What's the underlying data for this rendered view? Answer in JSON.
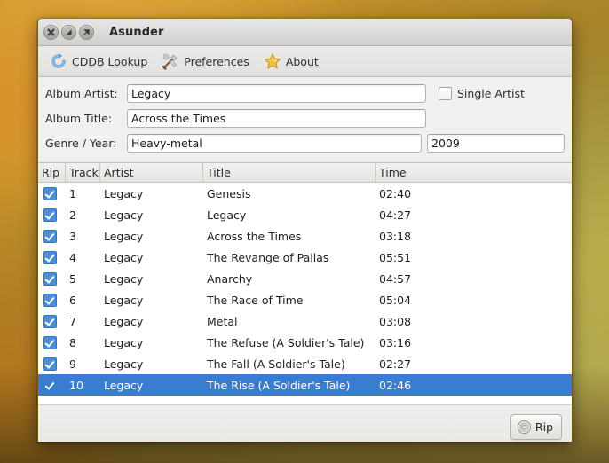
{
  "window": {
    "title": "Asunder",
    "controls": [
      {
        "name": "close",
        "icon": "close-icon"
      },
      {
        "name": "minimize",
        "icon": "minimize-icon"
      },
      {
        "name": "maximize",
        "icon": "maximize-icon"
      }
    ]
  },
  "toolbar": {
    "items": [
      {
        "label": "CDDB Lookup",
        "icon": "refresh-icon"
      },
      {
        "label": "Preferences",
        "icon": "tools-icon"
      },
      {
        "label": "About",
        "icon": "star-icon"
      }
    ]
  },
  "fields": {
    "album_artist": {
      "label": "Album Artist:",
      "value": "Legacy",
      "placeholder": ""
    },
    "album_title": {
      "label": "Album Title:",
      "value": "Across the Times",
      "placeholder": ""
    },
    "genre_year": {
      "label": "Genre / Year:",
      "genre_value": "Heavy-metal",
      "year_value": "2009",
      "genre_placeholder": "",
      "year_placeholder": ""
    },
    "single_artist": {
      "label": "Single Artist",
      "checked": false
    }
  },
  "tracklist": {
    "columns": [
      "Rip",
      "Track",
      "Artist",
      "Title",
      "Time"
    ],
    "rows": [
      {
        "rip": true,
        "track": "1",
        "artist": "Legacy",
        "title": "Genesis",
        "time": "02:40",
        "selected": false
      },
      {
        "rip": true,
        "track": "2",
        "artist": "Legacy",
        "title": "Legacy",
        "time": "04:27",
        "selected": false
      },
      {
        "rip": true,
        "track": "3",
        "artist": "Legacy",
        "title": "Across the Times",
        "time": "03:18",
        "selected": false
      },
      {
        "rip": true,
        "track": "4",
        "artist": "Legacy",
        "title": "The Revange of Pallas",
        "time": "05:51",
        "selected": false
      },
      {
        "rip": true,
        "track": "5",
        "artist": "Legacy",
        "title": "Anarchy",
        "time": "04:57",
        "selected": false
      },
      {
        "rip": true,
        "track": "6",
        "artist": "Legacy",
        "title": "The Race of Time",
        "time": "05:04",
        "selected": false
      },
      {
        "rip": true,
        "track": "7",
        "artist": "Legacy",
        "title": "Metal",
        "time": "03:08",
        "selected": false
      },
      {
        "rip": true,
        "track": "8",
        "artist": "Legacy",
        "title": "The Refuse (A Soldier's Tale)",
        "time": "03:16",
        "selected": false
      },
      {
        "rip": true,
        "track": "9",
        "artist": "Legacy",
        "title": "The Fall (A Soldier's Tale)",
        "time": "02:27",
        "selected": false
      },
      {
        "rip": true,
        "track": "10",
        "artist": "Legacy",
        "title": "The Rise (A Soldier's Tale)",
        "time": "02:46",
        "selected": true
      }
    ]
  },
  "bottom": {
    "rip_label": "Rip",
    "rip_icon": "disc-icon"
  },
  "colors": {
    "selection_blue": "#3a7cd0",
    "checkbox_blue": "#4a8fd8",
    "window_bg": "#f0efee",
    "list_bg": "#ffffff"
  }
}
